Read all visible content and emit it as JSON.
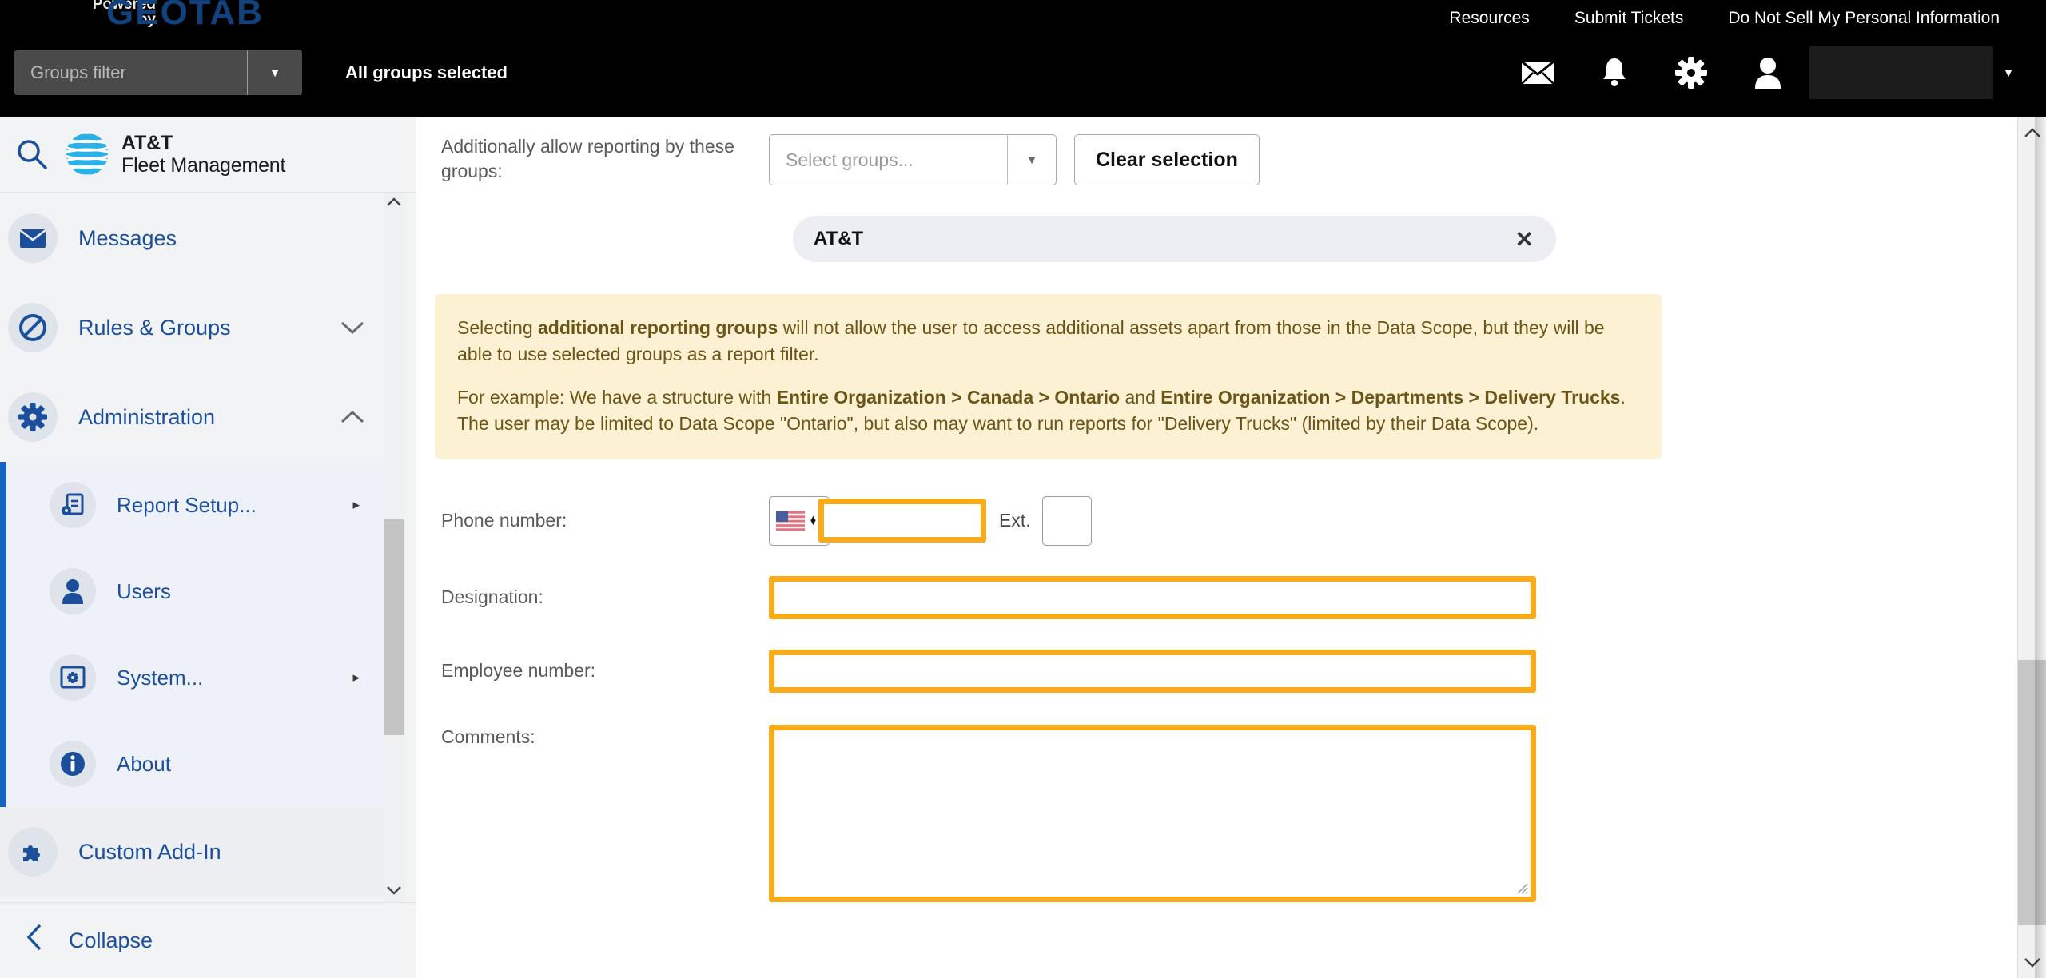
{
  "topbar": {
    "powered_line1": "Powered",
    "powered_line2": "by",
    "geotab": "GEOTAB",
    "nav_links": [
      {
        "label": "Resources"
      },
      {
        "label": "Submit Tickets"
      },
      {
        "label": "Do Not Sell My Personal Information"
      }
    ],
    "groups_filter_placeholder": "Groups filter",
    "groups_filter_arrow": "▼",
    "all_groups_selected": "All groups selected",
    "icons": {
      "mail": "mail-icon",
      "bell": "bell-icon",
      "gear": "gear-icon",
      "user": "user-icon"
    },
    "user_name": "",
    "user_caret": "▼"
  },
  "sidebar": {
    "search_icon": "search-icon",
    "brand_line1": "AT&T",
    "brand_line2": "Fleet Management",
    "items": [
      {
        "label": "Messages",
        "icon": "envelope-icon",
        "chevron": ""
      },
      {
        "label": "Rules & Groups",
        "icon": "prohibit-icon",
        "chevron": "⌄"
      },
      {
        "label": "Administration",
        "icon": "gear-icon",
        "chevron": "⌃"
      }
    ],
    "sub_items": [
      {
        "label": "Report Setup...",
        "icon": "report-setup-icon",
        "arrow": "▸"
      },
      {
        "label": "Users",
        "icon": "user-icon",
        "arrow": ""
      },
      {
        "label": "System...",
        "icon": "system-icon",
        "arrow": "▸"
      },
      {
        "label": "About",
        "icon": "info-icon",
        "arrow": ""
      }
    ],
    "addin": {
      "label": "Custom Add-In",
      "icon": "puzzle-icon"
    },
    "collapse": {
      "label": "Collapse",
      "icon": "chevron-left-icon"
    },
    "scroll_up": "⌃",
    "scroll_down": "⌄"
  },
  "main": {
    "reporting_groups": {
      "label": "Additionally allow reporting by these groups:",
      "select_placeholder": "Select groups...",
      "select_arrow": "▼",
      "clear_button": "Clear selection",
      "chip_label": "AT&T",
      "chip_remove": "✕"
    },
    "info_box": {
      "p1_a": "Selecting ",
      "p1_b": "additional reporting groups",
      "p1_c": " will not allow the user to access additional assets apart from those in the Data Scope, but they will be able to use selected groups as a report filter.",
      "p2_a": "For example: We have a structure with ",
      "p2_b": "Entire Organization > Canada > Ontario",
      "p2_c": " and ",
      "p2_d": "Entire Organization > Departments > Delivery Trucks",
      "p2_e": ". The user may be limited to Data Scope \"Ontario\", but also may want to run reports for \"Delivery Trucks\" (limited by their Data Scope)."
    },
    "phone": {
      "label": "Phone number:",
      "country_icon": "us-flag-icon",
      "spin_up": "▲",
      "spin_down": "▼",
      "value": "",
      "ext_label": "Ext.",
      "ext_value": ""
    },
    "designation": {
      "label": "Designation:",
      "value": ""
    },
    "employee_number": {
      "label": "Employee number:",
      "value": ""
    },
    "comments": {
      "label": "Comments:",
      "value": ""
    },
    "scroll_up": "⌃",
    "scroll_down": "⌄"
  },
  "colors": {
    "header_bg": "#000000",
    "geotab_blue": "#12427e",
    "sidebar_bg": "#f2f3f5",
    "nav_blue": "#1b4f9c",
    "accent_blue": "#1565c0",
    "highlight_orange": "#f9ab19",
    "info_bg": "#fdf1d4",
    "info_text": "#6b5516"
  }
}
